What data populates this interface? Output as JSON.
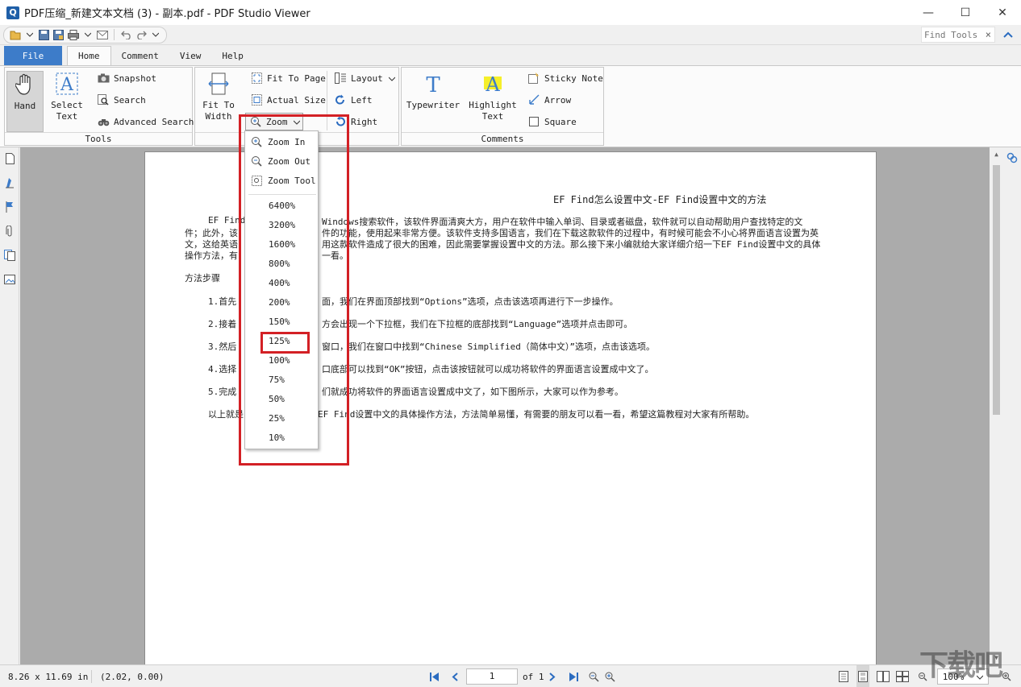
{
  "window": {
    "title": "PDF压缩_新建文本文档 (3) - 副本.pdf - PDF Studio Viewer",
    "app_icon_letter": "Q",
    "minimize": "—",
    "maximize": "☐",
    "close": "✕"
  },
  "quick_access": {
    "find_placeholder": "Find Tools",
    "find_clear": "×",
    "collapse": "⌃"
  },
  "tabs": [
    "File",
    "Home",
    "Comment",
    "View",
    "Help"
  ],
  "ribbon": {
    "tools": {
      "label": "Tools",
      "hand": "Hand",
      "select_text_1": "Select",
      "select_text_2": "Text",
      "snapshot": "Snapshot",
      "search": "Search",
      "advanced_search": "Advanced Search"
    },
    "view": {
      "fit_to_width_1": "Fit To",
      "fit_to_width_2": "Width",
      "fit_to_page": "Fit To Page",
      "actual_size": "Actual Size",
      "zoom": "Zoom",
      "layout": "Layout",
      "left": "Left",
      "right": "Right"
    },
    "comments": {
      "label": "Comments",
      "typewriter": "Typewriter",
      "highlight_1": "Highlight",
      "highlight_2": "Text",
      "sticky_note": "Sticky Note",
      "arrow": "Arrow",
      "square": "Square"
    }
  },
  "zoom_menu": {
    "zoom_in": "Zoom In",
    "zoom_out": "Zoom Out",
    "zoom_tool": "Zoom Tool",
    "levels": [
      "6400%",
      "3200%",
      "1600%",
      "800%",
      "400%",
      "200%",
      "150%",
      "125%",
      "100%",
      "75%",
      "50%",
      "25%",
      "10%"
    ],
    "highlighted": "125%"
  },
  "document": {
    "title": "EF Find怎么设置中文-EF Find设置中文的方法",
    "p1_line1_a": "EF Find",
    "p1_line1_b": "Windows搜索软件，该软件界面清爽大方，用户在软件中输入单词、目录或者磁盘，软件就可以自动帮助用户查找特定的文",
    "p1_line2_a": "件；此外，该",
    "p1_line2_b": "件的功能，使用起来非常方便。该软件支持多国语言，我们在下载这款软件的过程中，有时候可能会不小心将界面语言设置为英",
    "p1_line3_a": "文，这给英语",
    "p1_line3_b": "用这款软件造成了很大的困难，因此需要掌握设置中文的方法。那么接下来小编就给大家详细介绍一下EF Find设置中文的具体",
    "p1_line4_a": "操作方法，有",
    "p1_line4_b": "一看。",
    "steps_heading": "方法步骤",
    "step1_a": "1.首先",
    "step1_b": "面，我们在界面顶部找到“Options”选项，点击该选项再进行下一步操作。",
    "step2_a": "2.接着",
    "step2_b": "方会出现一个下拉框，我们在下拉框的底部找到“Language”选项并点击即可。",
    "step3_a": "3.然后",
    "step3_b": "窗口，我们在窗口中找到“Chinese Simplified（简体中文）”选项，点击该选项。",
    "step4_a": "4.选择",
    "step4_b": "口底部可以找到“OK”按钮，点击该按钮就可以成功将软件的界面语言设置成中文了。",
    "step5_a": "5.完成",
    "step5_b": "们就成功将软件的界面语言设置成中文了，如下图所示，大家可以作为参考。",
    "closing_a": "以上就是",
    "closing_b": "EF Find设置中文的具体操作方法，方法简单易懂，有需要的朋友可以看一看，希望这篇教程对大家有所帮助。"
  },
  "status": {
    "page_size": "8.26 x 11.69 in",
    "coords": "(2.02, 0.00)",
    "page_number": "1",
    "page_of": "of 1",
    "zoom_value": "100%"
  },
  "watermark": "下载吧",
  "colors": {
    "accent": "#3d7cc9",
    "highlight_box": "#d32025"
  }
}
